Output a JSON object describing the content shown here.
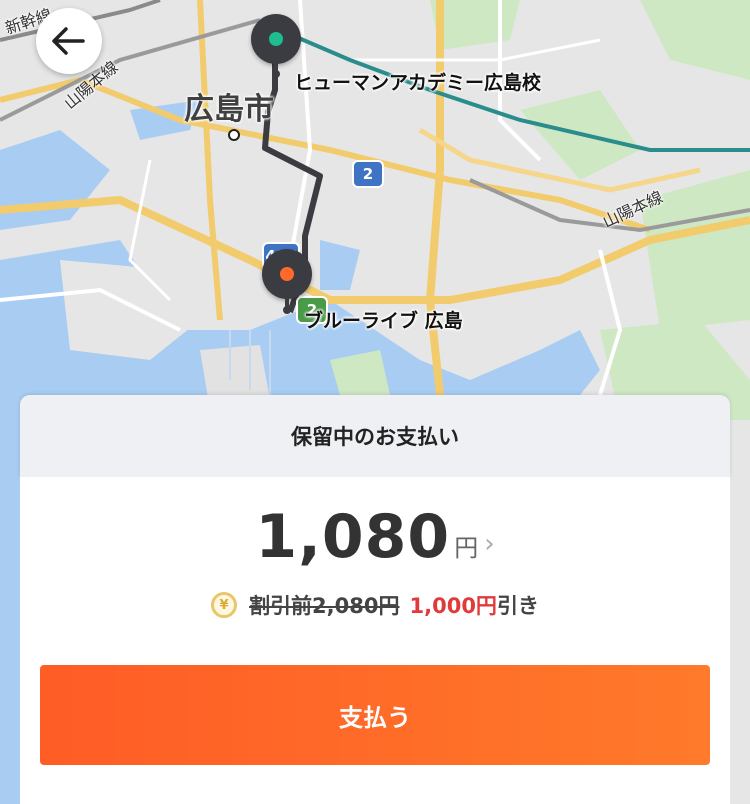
{
  "map": {
    "city_label": "広島市",
    "origin_label": "ヒューマンアカデミー広島校",
    "destination_label": "ブルーライブ 広島",
    "rail_labels": [
      "山陽本線",
      "山陽本線",
      "新幹線"
    ],
    "route_shields": [
      "2",
      "487",
      "2"
    ],
    "colors": {
      "water": "#a9cdf2",
      "land": "#e6e6e6",
      "park": "#cfe8c4",
      "route": "#3b3b42",
      "origin_dot": "#1dbd8f",
      "destination_dot": "#ff6a2b",
      "highway": "#f2cb6c"
    }
  },
  "back_button": {
    "icon": "arrow-left-icon"
  },
  "payment": {
    "header_title": "保留中のお支払い",
    "amount": "1,080",
    "currency_unit": "円",
    "before_discount": "割引前2,080円",
    "discount_amount": "1,000円",
    "discount_suffix": "引き",
    "coin_symbol": "¥",
    "pay_label": "支払う",
    "accent_color": "#ff6a2b",
    "discount_color": "#e03a3a"
  }
}
